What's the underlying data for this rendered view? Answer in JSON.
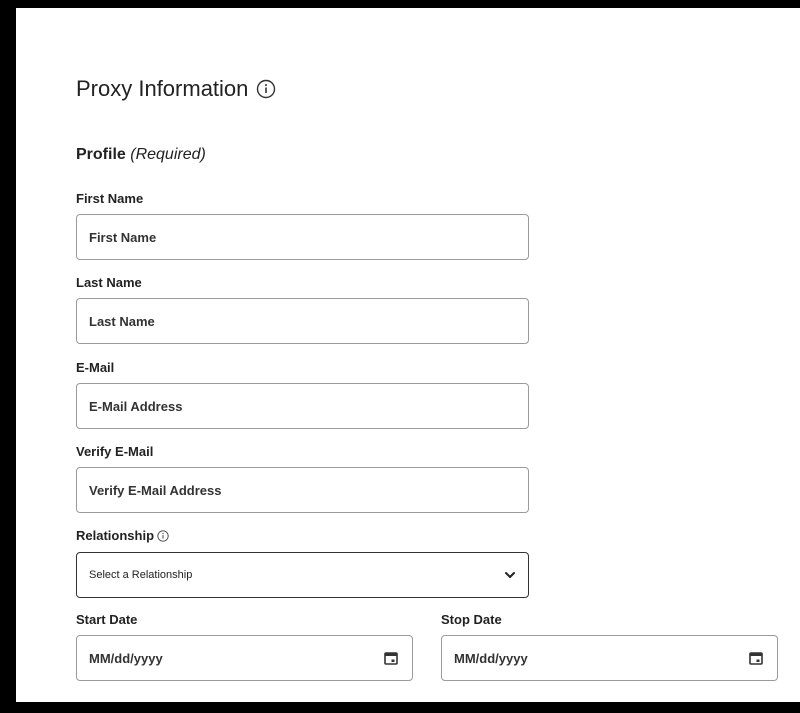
{
  "form": {
    "title": "Proxy Information",
    "profile_title": "Profile",
    "profile_required": "(Required)",
    "first_name": {
      "label": "First Name",
      "placeholder": "First Name"
    },
    "last_name": {
      "label": "Last Name",
      "placeholder": "Last Name"
    },
    "email": {
      "label": "E-Mail",
      "placeholder": "E-Mail Address"
    },
    "verify_email": {
      "label": "Verify E-Mail",
      "placeholder": "Verify E-Mail Address"
    },
    "relationship": {
      "label": "Relationship",
      "selected": "Select a Relationship"
    },
    "start_date": {
      "label": "Start Date",
      "placeholder": "MM/dd/yyyy"
    },
    "stop_date": {
      "label": "Stop Date",
      "placeholder": "MM/dd/yyyy"
    }
  },
  "icons": {
    "title_info": "info-icon",
    "relationship_info": "info-icon",
    "relationship_dropdown": "chevron-down-icon",
    "start_date_picker": "calendar-icon",
    "stop_date_picker": "calendar-icon"
  },
  "colors": {
    "frame_border": "#000000",
    "background": "#ffffff",
    "text": "#222222",
    "input_border": "#9a9a9a"
  }
}
